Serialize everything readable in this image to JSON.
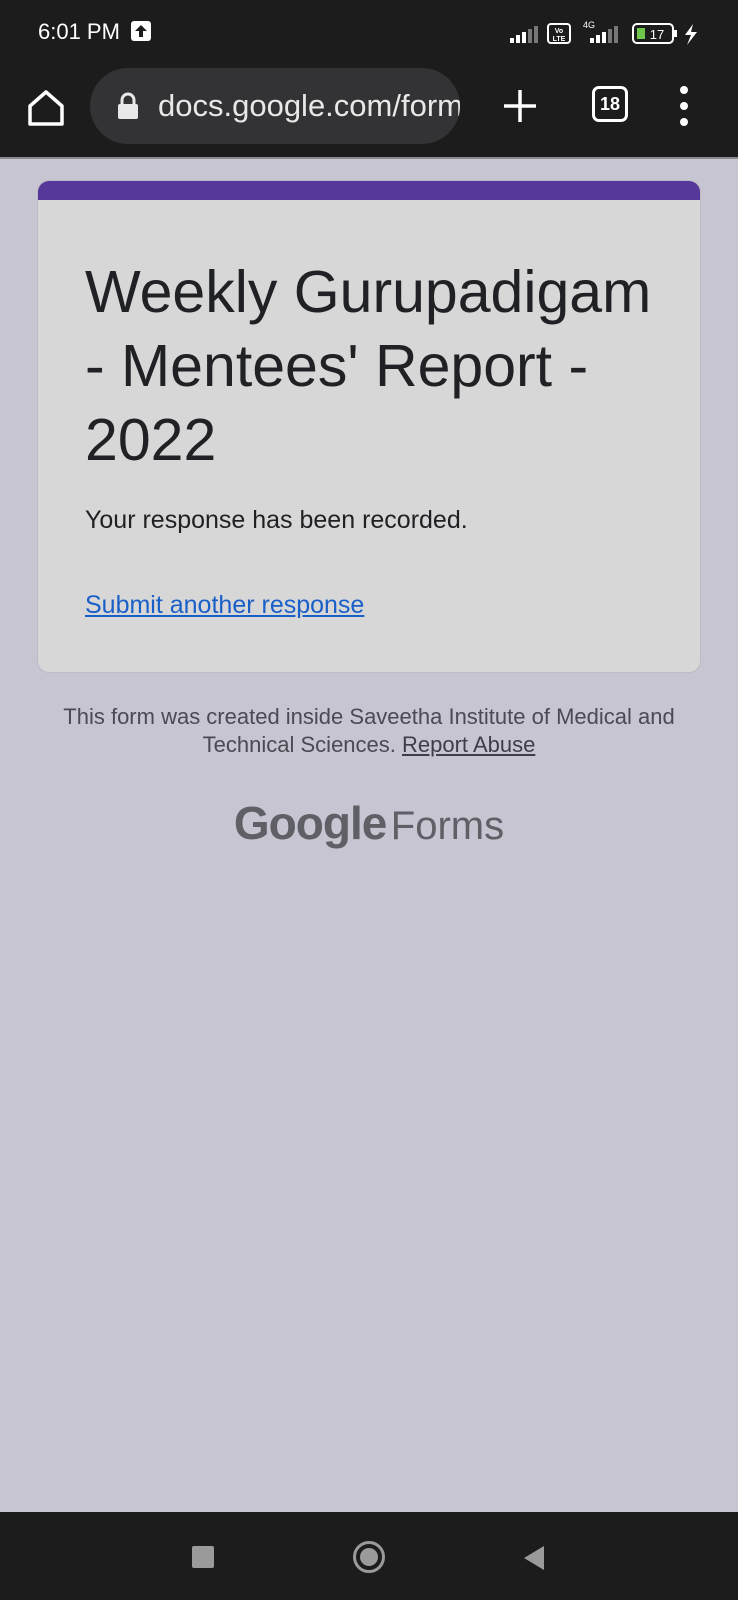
{
  "status_bar": {
    "time": "6:01 PM",
    "network": "4G",
    "volte": "Vo LTE",
    "battery": "17"
  },
  "toolbar": {
    "url": "docs.google.com/forms",
    "tab_count": "18"
  },
  "form": {
    "title": "Weekly Gurupadigam - Mentees' Report - 2022",
    "response_message": "Your response has been recorded.",
    "submit_another_label": "Submit another response",
    "accent_color": "#56379a"
  },
  "footer": {
    "text": "This form was created inside Saveetha Institute of Medical and Technical Sciences.",
    "report_abuse_label": "Report Abuse",
    "brand_google": "Google",
    "brand_forms": "Forms"
  },
  "icons": {
    "home": "home-icon",
    "lock": "lock-icon",
    "new_tab": "plus-icon",
    "menu": "more-vert-icon"
  }
}
